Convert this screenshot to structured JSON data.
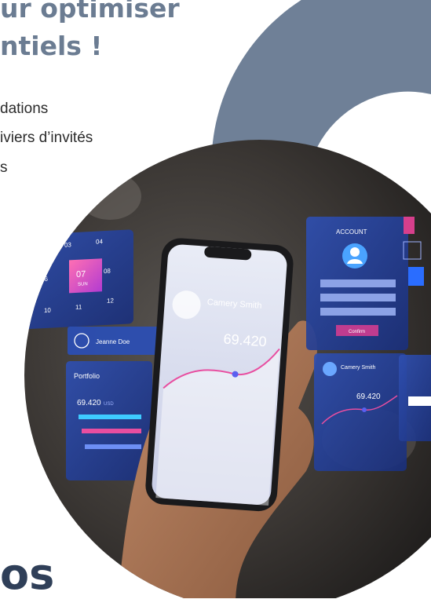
{
  "heading": {
    "line1": "ur optimiser",
    "line2": "ntiels !"
  },
  "bullets": [
    "dations",
    "iviers d’invités",
    "s"
  ],
  "bottom_text": "os",
  "ui": {
    "account_title": "ACCOUNT",
    "confirm": "Confirm",
    "username_label": "Jeanne Doe",
    "portfolio_title": "Portfolio",
    "portfolio_value": "69.420",
    "portfolio_currency": "USD",
    "phone_name": "Camery Smith",
    "phone_value": "69.420",
    "card_name": "Camery Smith",
    "card_value": "69.420",
    "cal_day": "07",
    "cal_weekday": "SUN",
    "cal_nums": [
      "03",
      "04",
      "06",
      "08",
      "10",
      "11",
      "12"
    ]
  },
  "colors": {
    "heading": "#6b7c92",
    "arc": "#6f8097",
    "panel": "#1e3a8a",
    "accent": "#d63f8c"
  }
}
